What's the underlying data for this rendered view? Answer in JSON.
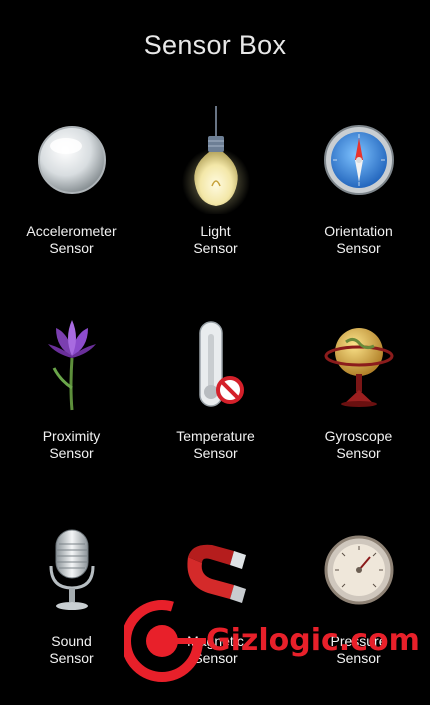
{
  "app": {
    "title": "Sensor Box"
  },
  "sensors": [
    {
      "line1": "Accelerometer",
      "line2": "Sensor",
      "icon": "glass-sphere-icon"
    },
    {
      "line1": "Light",
      "line2": "Sensor",
      "icon": "light-bulb-icon"
    },
    {
      "line1": "Orientation",
      "line2": "Sensor",
      "icon": "compass-icon"
    },
    {
      "line1": "Proximity",
      "line2": "Sensor",
      "icon": "crocus-flower-icon"
    },
    {
      "line1": "Temperature",
      "line2": "Sensor",
      "icon": "thermometer-icon",
      "disabled": true
    },
    {
      "line1": "Gyroscope",
      "line2": "Sensor",
      "icon": "globe-icon"
    },
    {
      "line1": "Sound",
      "line2": "Sensor",
      "icon": "microphone-icon"
    },
    {
      "line1": "Magnetic",
      "line2": "Sensor",
      "icon": "magnet-icon"
    },
    {
      "line1": "Pressure",
      "line2": "Sensor",
      "icon": "barometer-icon"
    }
  ],
  "watermark": {
    "text": "Gizlogic.com",
    "color": "#e8202a"
  }
}
